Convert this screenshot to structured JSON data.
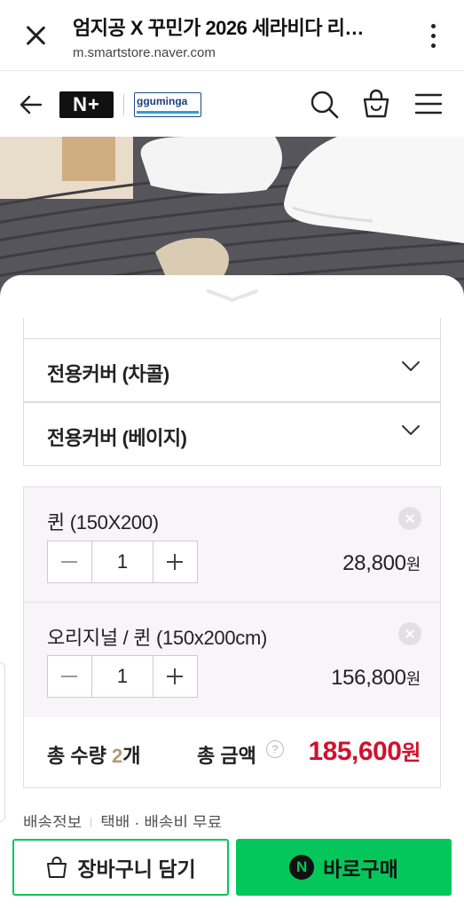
{
  "browser": {
    "title": "엄지공 X 꾸민가 2026 세라비다 리…",
    "url": "m.smartstore.naver.com"
  },
  "header": {
    "store_logo": "N+",
    "brand_logo": "gguminga"
  },
  "options": [
    {
      "label": "전용커버 (차콜)"
    },
    {
      "label": "전용커버 (베이지)"
    }
  ],
  "selected_items": [
    {
      "name": "퀸 (150X200)",
      "quantity": "1",
      "price": "28,800",
      "currency": "원"
    },
    {
      "name": "오리지널 / 퀸 (150x200cm)",
      "quantity": "1",
      "price": "156,800",
      "currency": "원"
    }
  ],
  "totals": {
    "qty_label_prefix": "총 수량 ",
    "qty_value": "2",
    "qty_suffix": "개",
    "amount_label": "총 금액",
    "help_glyph": "?",
    "amount": "185,600",
    "currency": "원"
  },
  "shipping": {
    "label": "배송정보",
    "value": "택배 · 배송비 무료"
  },
  "cta": {
    "cart_label": "장바구니 담기",
    "buy_label": "바로구매",
    "npay_glyph": "N"
  },
  "colors": {
    "naver_green": "#03c75a",
    "price_red": "#d1102f",
    "qty_accent": "#b39a75"
  }
}
